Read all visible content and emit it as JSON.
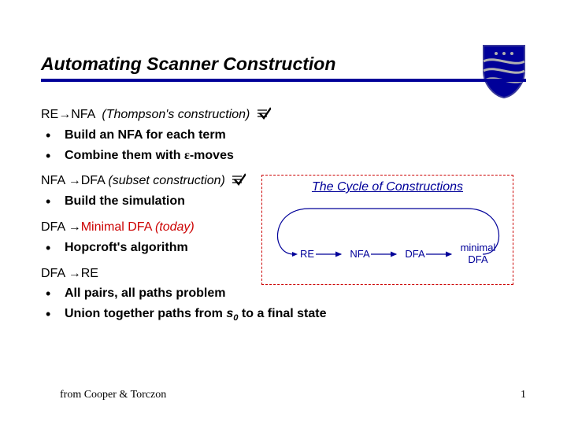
{
  "title": "Automating Scanner Construction",
  "sections": [
    {
      "lhs": "RE",
      "rhs": "NFA",
      "paren": "(Thompson's construction)",
      "red_rhs": false,
      "checked": true,
      "bullets": [
        "Build an NFA for each term",
        "Combine them with ε-moves"
      ]
    },
    {
      "lhs": "NFA ",
      "rhs": "DFA",
      "paren": "(subset construction)",
      "red_rhs": false,
      "checked": true,
      "bullets": [
        "Build the simulation"
      ]
    },
    {
      "lhs": "DFA ",
      "rhs": "Minimal DFA",
      "paren": "(today)",
      "red_rhs": true,
      "checked": false,
      "bullets": [
        "Hopcroft's algorithm"
      ]
    },
    {
      "lhs": "DFA ",
      "rhs": "RE",
      "paren": "",
      "red_rhs": false,
      "checked": false,
      "bullets": [
        "All pairs, all paths problem",
        "Union together paths from s₀ to a final state"
      ]
    }
  ],
  "diagram": {
    "title": "The Cycle of Constructions",
    "nodes": [
      "RE",
      "NFA",
      "DFA",
      "minimal\nDFA"
    ]
  },
  "footer": {
    "left": "from Cooper & Torczon",
    "right": "1"
  },
  "colors": {
    "accent": "#000099",
    "red": "#cc0000"
  }
}
